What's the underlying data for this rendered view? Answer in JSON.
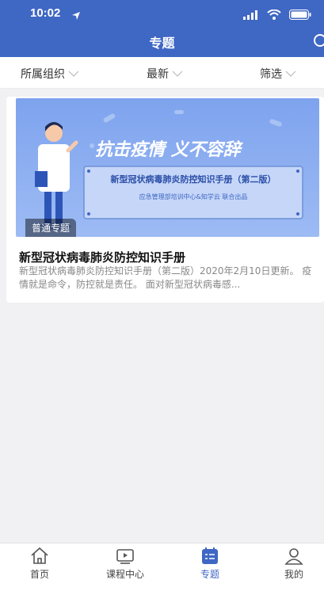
{
  "status_bar": {
    "time": "10:02"
  },
  "nav": {
    "title": "专题"
  },
  "filters": [
    {
      "label": "所属组织"
    },
    {
      "label": "最新"
    },
    {
      "label": "筛选"
    }
  ],
  "card": {
    "banner": {
      "headline": "抗击疫情 义不容辞",
      "book_title": "新型冠状病毒肺炎防控知识手册（第二版）",
      "publisher": "应急管理部培训中心&知学云  联合出品"
    },
    "tag": "普通专题",
    "title": "新型冠状病毒肺炎防控知识手册",
    "description": "新型冠状病毒肺炎防控知识手册（第二版）2020年2月10日更新。 疫情就是命令，防控就是责任。 面对新型冠状病毒感..."
  },
  "tabs": [
    {
      "label": "首页",
      "icon": "home-icon",
      "active": false
    },
    {
      "label": "课程中心",
      "icon": "course-icon",
      "active": false
    },
    {
      "label": "专题",
      "icon": "topic-icon",
      "active": true
    },
    {
      "label": "我的",
      "icon": "profile-icon",
      "active": false
    }
  ],
  "colors": {
    "primary": "#3f67c4",
    "banner_bg": "#8aaef0"
  }
}
